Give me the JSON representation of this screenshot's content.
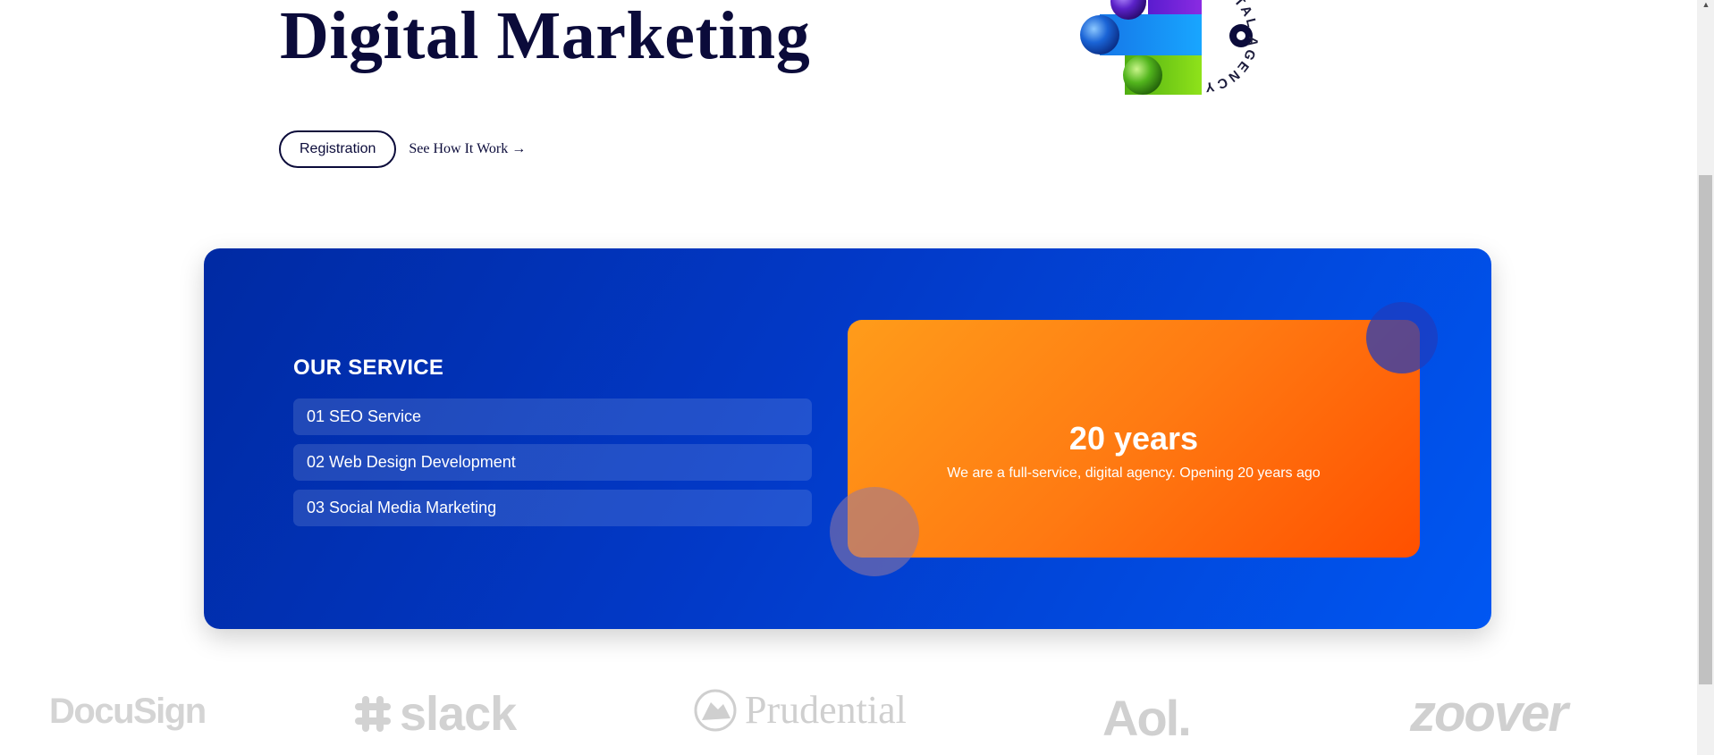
{
  "hero": {
    "title": "Digital Marketing",
    "registration_label": "Registration",
    "see_how_label": "See How It Work →"
  },
  "logo": {
    "ring_text": "DIGITAL AGENCY",
    "icon": "agency-logo-icon",
    "colors": [
      "#7a1bd6",
      "#1d8cf5",
      "#7ed321"
    ]
  },
  "service": {
    "heading": "OUR SERVICE",
    "items": [
      {
        "label": "01 SEO Service"
      },
      {
        "label": "02 Web Design Development"
      },
      {
        "label": "03 Social Media Marketing"
      }
    ]
  },
  "stat_card": {
    "value": "20 years",
    "text": "We are a full-service, digital agency. Opening 20 years ago"
  },
  "brands": [
    "DocuSign",
    "slack",
    "Prudential",
    "Aol.",
    "zoover"
  ],
  "colors": {
    "panel_blue": "#0239c7",
    "card_orange": "#ff7a12",
    "title_navy": "#0b0b3a"
  }
}
